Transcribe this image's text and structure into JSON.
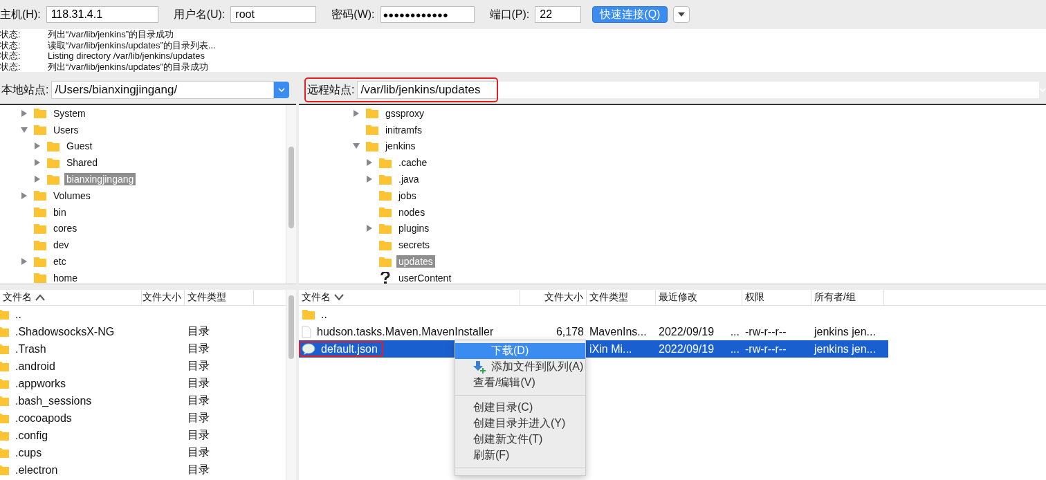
{
  "quickconnect": {
    "fields": [
      {
        "label": "主机(H):",
        "value": "118.31.4.1"
      },
      {
        "label": "用户名(U):",
        "value": "root"
      },
      {
        "label": "密码(W):",
        "value": "●●●●●●●●●●●●"
      },
      {
        "label": "端口(P):",
        "value": "22"
      }
    ],
    "button": "快速连接(Q)"
  },
  "log": [
    {
      "label": "状态:",
      "text": "列出“/var/lib/jenkins”的目录成功"
    },
    {
      "label": "状态:",
      "text": "读取“/var/lib/jenkins/updates”的目录列表..."
    },
    {
      "label": "状态:",
      "text": "Listing directory /var/lib/jenkins/updates"
    },
    {
      "label": "状态:",
      "text": "列出“/var/lib/jenkins/updates”的目录成功"
    }
  ],
  "local": {
    "site_label": "本地站点:",
    "site_path": "/Users/bianxingjingang/",
    "annotated": false,
    "tree": [
      {
        "name": "System",
        "kind": "folder",
        "expanded": false,
        "selected": false
      },
      {
        "name": "Users",
        "kind": "folder",
        "expanded": true,
        "selected": false,
        "children": [
          {
            "name": "Guest",
            "kind": "folder",
            "expanded": false,
            "selected": false
          },
          {
            "name": "Shared",
            "kind": "folder",
            "expanded": false,
            "selected": false
          },
          {
            "name": "bianxingjingang",
            "kind": "folder",
            "expanded": false,
            "selected": true
          }
        ]
      },
      {
        "name": "Volumes",
        "kind": "folder",
        "expanded": false,
        "selected": false
      },
      {
        "name": "bin",
        "kind": "folder",
        "selected": false
      },
      {
        "name": "cores",
        "kind": "folder",
        "selected": false
      },
      {
        "name": "dev",
        "kind": "folder",
        "selected": false
      },
      {
        "name": "etc",
        "kind": "folder",
        "expanded": false,
        "selected": false
      },
      {
        "name": "home",
        "kind": "folder",
        "selected": false
      }
    ],
    "columns": [
      {
        "label": "文件名",
        "sort_ascending": true
      },
      {
        "label": "文件大小"
      },
      {
        "label": "文件类型"
      }
    ],
    "rows": [
      {
        "kind": "folder",
        "name": "..",
        "selected": false,
        "annotated": false
      },
      {
        "kind": "folder",
        "name": ".ShadowsocksX-NG",
        "type": "目录",
        "selected": false,
        "annotated": false
      },
      {
        "kind": "folder",
        "name": ".Trash",
        "type": "目录",
        "selected": false,
        "annotated": false
      },
      {
        "kind": "folder",
        "name": ".android",
        "type": "目录",
        "selected": false,
        "annotated": false
      },
      {
        "kind": "folder",
        "name": ".appworks",
        "type": "目录",
        "selected": false,
        "annotated": false
      },
      {
        "kind": "folder",
        "name": ".bash_sessions",
        "type": "目录",
        "selected": false,
        "annotated": false
      },
      {
        "kind": "folder",
        "name": ".cocoapods",
        "type": "目录",
        "selected": false,
        "annotated": false
      },
      {
        "kind": "folder",
        "name": ".config",
        "type": "目录",
        "selected": false,
        "annotated": false
      },
      {
        "kind": "folder",
        "name": ".cups",
        "type": "目录",
        "selected": false,
        "annotated": false
      },
      {
        "kind": "folder",
        "name": ".electron",
        "type": "目录",
        "selected": false,
        "annotated": false
      }
    ]
  },
  "remote": {
    "site_label": "远程站点:",
    "site_path": "/var/lib/jenkins/updates",
    "annotated": true,
    "tree": [
      {
        "name": "gssproxy",
        "kind": "folder",
        "expanded": false,
        "selected": false
      },
      {
        "name": "initramfs",
        "kind": "folder",
        "selected": false
      },
      {
        "name": "jenkins",
        "kind": "folder",
        "expanded": true,
        "selected": false,
        "children": [
          {
            "name": ".cache",
            "kind": "folder",
            "expanded": false,
            "selected": false
          },
          {
            "name": ".java",
            "kind": "folder",
            "expanded": false,
            "selected": false
          },
          {
            "name": "jobs",
            "kind": "folder",
            "selected": false
          },
          {
            "name": "nodes",
            "kind": "folder",
            "selected": false
          },
          {
            "name": "plugins",
            "kind": "folder",
            "expanded": false,
            "selected": false
          },
          {
            "name": "secrets",
            "kind": "folder",
            "selected": false
          },
          {
            "name": "updates",
            "kind": "folder",
            "selected": true
          },
          {
            "name": "userContent",
            "kind": "unknown",
            "selected": false
          }
        ]
      }
    ],
    "columns": [
      {
        "label": "文件名",
        "sort_ascending": false
      },
      {
        "label": "文件大小"
      },
      {
        "label": "文件类型"
      },
      {
        "label": "最近修改"
      },
      {
        "label": "权限"
      },
      {
        "label": "所有者/组"
      }
    ],
    "rows": [
      {
        "kind": "folder",
        "name": "..",
        "selected": false,
        "annotated": false
      },
      {
        "kind": "file",
        "name": "hudson.tasks.Maven.MavenInstaller",
        "size": "6,178",
        "type": "MavenIns...",
        "modified": [
          "2022/09/19",
          "..."
        ],
        "permissions": "-rw-r--r--",
        "owner": "jenkins jen...",
        "selected": false,
        "annotated": false
      },
      {
        "kind": "chat",
        "name": "default.json",
        "type": "iXin Mi...",
        "modified": [
          "2022/09/19",
          "..."
        ],
        "permissions": "-rw-r--r--",
        "owner": "jenkins jen...",
        "selected": true,
        "annotated": true
      }
    ]
  },
  "context_menu": [
    {
      "kind": "item",
      "label": "下载(D)",
      "selected": true
    },
    {
      "kind": "icon_item",
      "label": "添加文件到队列(A)",
      "selected": false
    },
    {
      "kind": "item",
      "label": "查看/编辑(V)",
      "selected": false
    },
    {
      "kind": "separator"
    },
    {
      "kind": "item",
      "label": "创建目录(C)",
      "selected": false
    },
    {
      "kind": "item",
      "label": "创建目录并进入(Y)",
      "selected": false
    },
    {
      "kind": "item",
      "label": "创建新文件(T)",
      "selected": false
    },
    {
      "kind": "item",
      "label": "刷新(F)",
      "selected": false
    },
    {
      "kind": "separator"
    }
  ]
}
